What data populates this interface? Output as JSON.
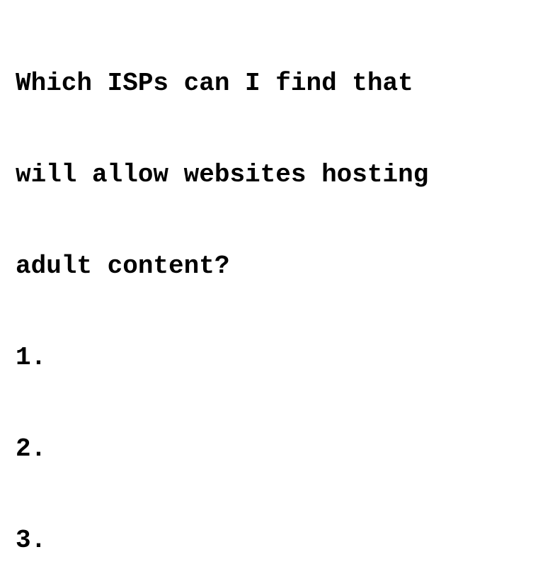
{
  "document": {
    "question_lines": [
      "Which ISPs can I find that",
      "will allow websites hosting",
      "adult content?"
    ],
    "list_markers": [
      "1.",
      "2.",
      "3."
    ]
  }
}
